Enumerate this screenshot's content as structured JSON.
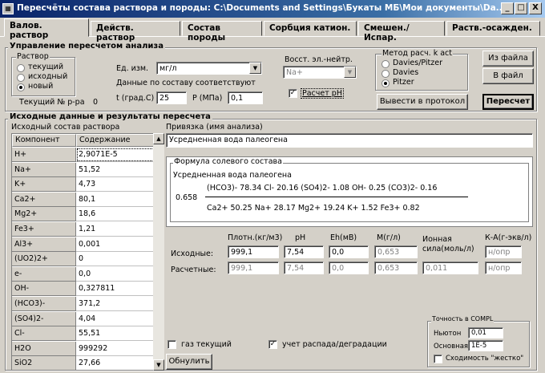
{
  "window": {
    "title": "Пересчёты состава раствора и породы: C:\\Documents and Settings\\Букаты МБ\\Мои документы\\Da...",
    "icon": "app-icon",
    "buttons": [
      "_",
      "□",
      "X"
    ]
  },
  "tabs": [
    "Валов. раствор",
    "Действ. раствор",
    "Состав породы",
    "Сорбция катион.",
    "Смешен./Испар.",
    "Раств.-осажден."
  ],
  "control": {
    "group_title": "Управление пересчетом анализа",
    "solution_group": "Раствор",
    "radios": [
      {
        "label": "текущий",
        "checked": false
      },
      {
        "label": "исходный",
        "checked": false
      },
      {
        "label": "новый",
        "checked": true
      }
    ],
    "current_label": "Текущий № р-ра",
    "current_value": "0",
    "units_label": "Ед. изм.",
    "units_value": "мг/л",
    "data_label": "Данные по составу соответствуют",
    "t_label": "t (град.С)",
    "t_value": "25",
    "p_label": "P (МПа)",
    "p_value": "0,1",
    "electro_label": "Восст. эл.-нейтр.",
    "electro_value": "Na+",
    "calc_ph_label": "Расчет pH",
    "calc_ph_checked": true,
    "method_group": "Метод расч. k act",
    "methods": [
      {
        "label": "Davies/Pitzer",
        "checked": false
      },
      {
        "label": "Davies",
        "checked": false
      },
      {
        "label": "Pitzer",
        "checked": true
      }
    ],
    "protocol_button": "Вывести в протокол",
    "from_file_button": "Из файла",
    "to_file_button": "В файл",
    "recalc_button": "Пересчет"
  },
  "results": {
    "group_title": "Исходные данные и результаты пересчета",
    "initial_label": "Исходный состав раствора",
    "columns": [
      "Компонент",
      "Содержание"
    ],
    "rows": [
      [
        "H+",
        "2,9071E-5"
      ],
      [
        "Na+",
        "51,52"
      ],
      [
        "K+",
        "4,73"
      ],
      [
        "Ca2+",
        "80,1"
      ],
      [
        "Mg2+",
        "18,6"
      ],
      [
        "Fe3+",
        "1,21"
      ],
      [
        "Al3+",
        "0,001"
      ],
      [
        "(UO2)2+",
        "0"
      ],
      [
        "e-",
        "0,0"
      ],
      [
        "OH-",
        "0,327811"
      ],
      [
        "(HCO3)-",
        "371,2"
      ],
      [
        "(SO4)2-",
        "4,04"
      ],
      [
        "Cl-",
        "55,51"
      ],
      [
        "H2O",
        "999292"
      ],
      [
        "SiO2",
        "27,66"
      ]
    ],
    "binding_label": "Привязка (имя анализа)",
    "binding_value": "Усредненная вода палеогена",
    "formula_group": "Формула солевого состава",
    "formula_name": "Усредненная вода палеогена",
    "formula_coef": "0.658",
    "formula_top": "(HCO3)- 78.34 Cl- 20.16 (SO4)2- 1.08 OH- 0.25 (CO3)2- 0.16",
    "formula_bottom": "Ca2+ 50.25 Na+ 28.17 Mg2+ 19.24 K+ 1.52 Fe3+ 0.82",
    "prop_headers": [
      "Плотн.(кг/м3)",
      "pH",
      "Eh(мВ)",
      "М(г/л)",
      "Ионная сила(моль/л)",
      "К-А(г-экв/л)"
    ],
    "initial_row_label": "Исходные:",
    "initial_values": [
      "999,1",
      "7,54",
      "0,0",
      "0,653",
      "",
      "н/опр"
    ],
    "calc_row_label": "Расчетные:",
    "calc_values": [
      "999,1",
      "7,54",
      "0,0",
      "0,653",
      "0,011",
      "н/опр"
    ],
    "gas_label": "газ текущий",
    "gas_checked": false,
    "decay_label": "учет распада/деградации",
    "decay_checked": true,
    "reset_button": "Обнулить"
  },
  "precision": {
    "title": "Точность в COMPL",
    "newton_label": "Ньютон",
    "newton_value": "0,01",
    "main_label": "Основная",
    "main_value": "1E-5",
    "strict_label": "Сходимость \"жестко\"",
    "strict_checked": false
  }
}
